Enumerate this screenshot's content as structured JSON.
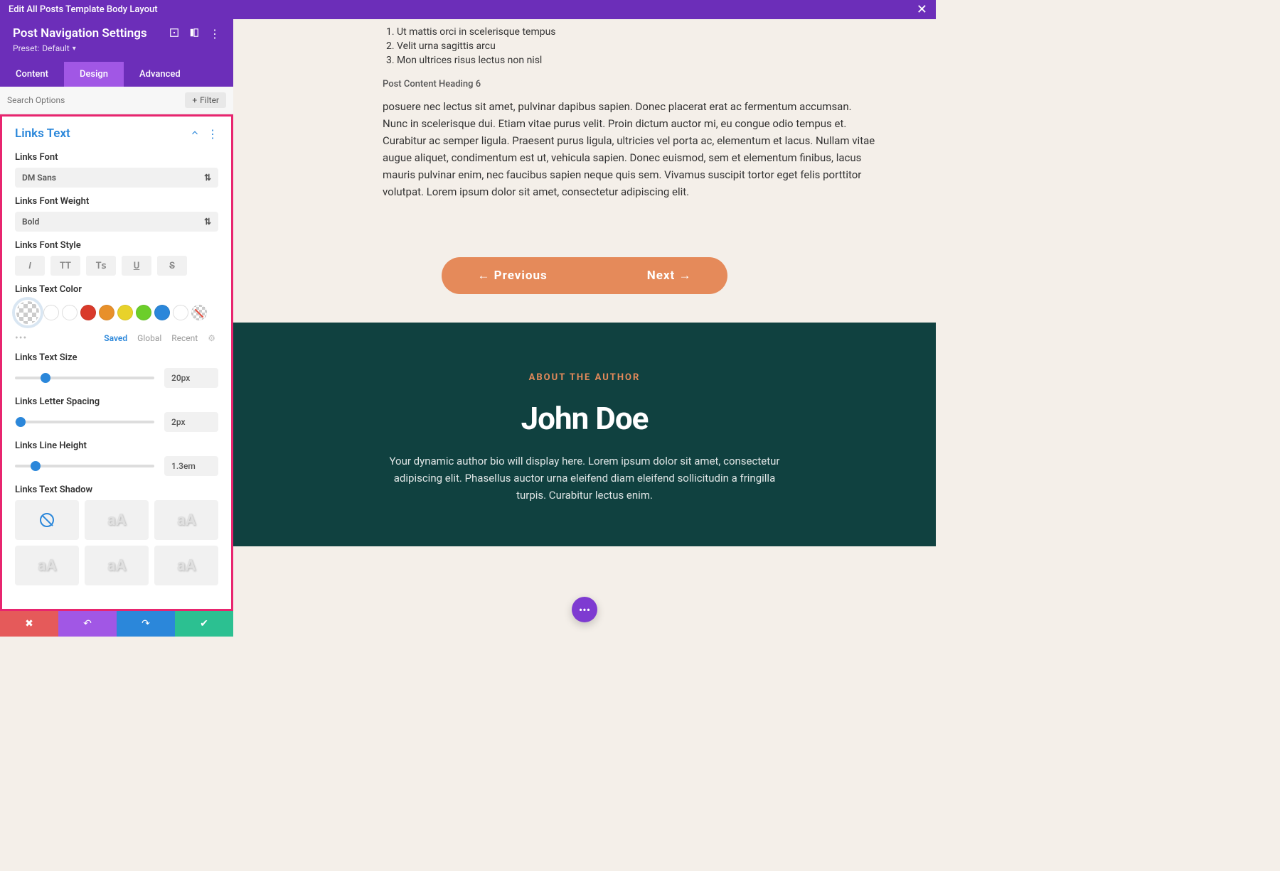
{
  "header": {
    "title": "Edit All Posts Template Body Layout"
  },
  "settings": {
    "title": "Post Navigation Settings",
    "preset_label": "Preset:",
    "preset_value": "Default"
  },
  "tabs": {
    "content": "Content",
    "design": "Design",
    "advanced": "Advanced"
  },
  "search": {
    "placeholder": "Search Options",
    "filter": "Filter"
  },
  "section": {
    "title": "Links Text"
  },
  "fields": {
    "font_label": "Links Font",
    "font_value": "DM Sans",
    "weight_label": "Links Font Weight",
    "weight_value": "Bold",
    "style_label": "Links Font Style",
    "color_label": "Links Text Color",
    "size_label": "Links Text Size",
    "size_value": "20px",
    "spacing_label": "Links Letter Spacing",
    "spacing_value": "2px",
    "lineheight_label": "Links Line Height",
    "lineheight_value": "1.3em",
    "shadow_label": "Links Text Shadow"
  },
  "style_buttons": {
    "italic": "I",
    "uppercase": "TT",
    "smallcaps": "Tꜱ",
    "underline": "U",
    "strike": "S"
  },
  "color_tabs": {
    "saved": "Saved",
    "global": "Global",
    "recent": "Recent"
  },
  "swatches": [
    "#d93a2b",
    "#e8902a",
    "#e8d22a",
    "#6cce2a",
    "#2b87da"
  ],
  "content": {
    "ol": [
      "Ut mattis orci in scelerisque tempus",
      "Velit urna sagittis arcu",
      "Mon ultrices risus lectus non nisl"
    ],
    "h6": "Post Content Heading 6",
    "para": "posuere nec lectus sit amet, pulvinar dapibus sapien. Donec placerat erat ac fermentum accumsan. Nunc in scelerisque dui. Etiam vitae purus velit. Proin dictum auctor mi, eu congue odio tempus et. Curabitur ac semper ligula. Praesent purus ligula, ultricies vel porta ac, elementum et lacus. Nullam vitae augue aliquet, condimentum est ut, vehicula sapien. Donec euismod, sem et elementum finibus, lacus mauris pulvinar enim, nec faucibus sapien neque quis sem. Vivamus suscipit tortor eget felis porttitor volutpat. Lorem ipsum dolor sit amet, consectetur adipiscing elit."
  },
  "nav": {
    "prev": "← Previous",
    "next": "Next →"
  },
  "author": {
    "label": "ABOUT THE AUTHOR",
    "name": "John Doe",
    "bio": "Your dynamic author bio will display here. Lorem ipsum dolor sit amet, consectetur adipiscing elit. Phasellus auctor urna eleifend diam eleifend sollicitudin a fringilla turpis. Curabitur lectus enim."
  },
  "footer_colors": {
    "discard": "#e55a5a",
    "undo": "#a157e5",
    "redo": "#2b87da",
    "save": "#2cc091"
  }
}
